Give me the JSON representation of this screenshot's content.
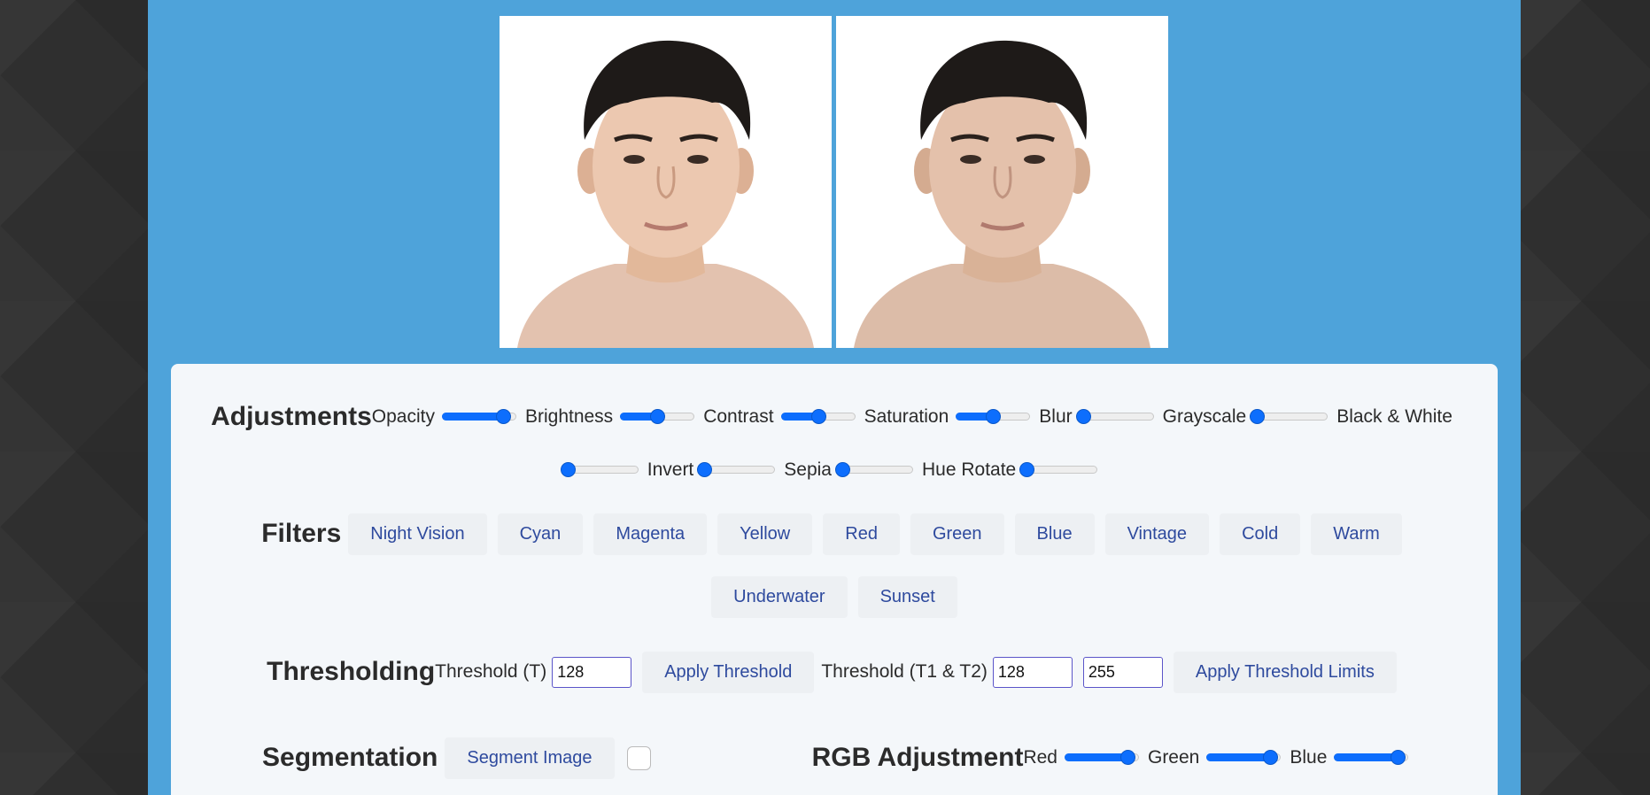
{
  "adjustments": {
    "title": "Adjustments",
    "sliders": [
      {
        "label": "Opacity",
        "value": 0.82
      },
      {
        "label": "Brightness",
        "value": 0.5
      },
      {
        "label": "Contrast",
        "value": 0.5
      },
      {
        "label": "Saturation",
        "value": 0.5
      },
      {
        "label": "Blur",
        "value": 0.05
      },
      {
        "label": "Grayscale",
        "value": 0.05
      },
      {
        "label": "Black & White",
        "value": 0.05
      },
      {
        "label": "Invert",
        "value": 0.05
      },
      {
        "label": "Sepia",
        "value": 0.05
      },
      {
        "label": "Hue Rotate",
        "value": 0.05
      }
    ]
  },
  "filters": {
    "title": "Filters",
    "buttons": [
      "Night Vision",
      "Cyan",
      "Magenta",
      "Yellow",
      "Red",
      "Green",
      "Blue",
      "Vintage",
      "Cold",
      "Warm",
      "Underwater",
      "Sunset"
    ]
  },
  "thresholding": {
    "title": "Thresholding",
    "single_label": "Threshold (T)",
    "single_value": "128",
    "apply_label": "Apply Threshold",
    "double_label": "Threshold (T1 & T2)",
    "t1_value": "128",
    "t2_value": "255",
    "apply_limits_label": "Apply Threshold Limits"
  },
  "segmentation": {
    "title": "Segmentation",
    "button_label": "Segment Image",
    "checked": false
  },
  "rgb": {
    "title": "RGB Adjustment",
    "sliders": [
      {
        "label": "Red",
        "value": 0.85
      },
      {
        "label": "Green",
        "value": 0.85
      },
      {
        "label": "Blue",
        "value": 0.85
      }
    ]
  },
  "images": {
    "original_alt": "portrait-original",
    "edited_alt": "portrait-edited"
  },
  "colors": {
    "page_blue": "#4ea3da",
    "accent": "#0d6efd",
    "button_text": "#2e4a9e",
    "panel": "#f4f7fa"
  }
}
